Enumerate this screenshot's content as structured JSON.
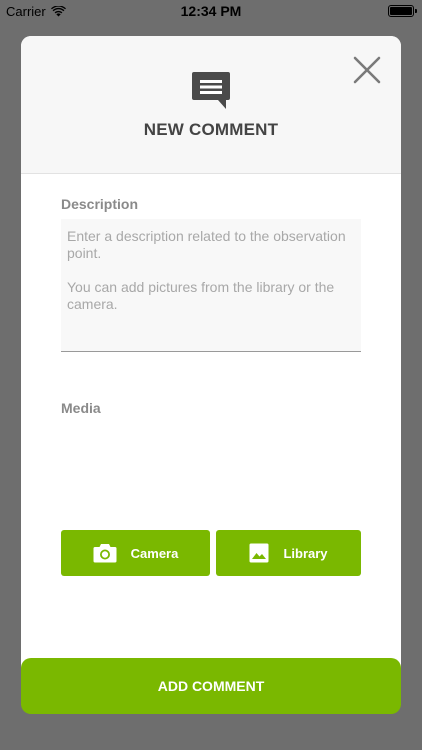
{
  "status_bar": {
    "carrier": "Carrier",
    "time": "12:34 PM"
  },
  "modal": {
    "icon": "comment-icon",
    "title": "NEW COMMENT",
    "close_icon": "close-icon"
  },
  "description": {
    "label": "Description",
    "placeholder": "Enter a description related to the observation point.\n\nYou can add pictures from the library or the camera.",
    "value": ""
  },
  "media": {
    "label": "Media",
    "camera_label": "Camera",
    "camera_icon": "camera-icon",
    "library_label": "Library",
    "library_icon": "image-icon"
  },
  "submit": {
    "label": "ADD COMMENT"
  },
  "colors": {
    "accent": "#7ab800",
    "backdrop": "#6e6e6e",
    "header_bg": "#f7f7f7",
    "title": "#444444",
    "label": "#8a8a8a"
  }
}
